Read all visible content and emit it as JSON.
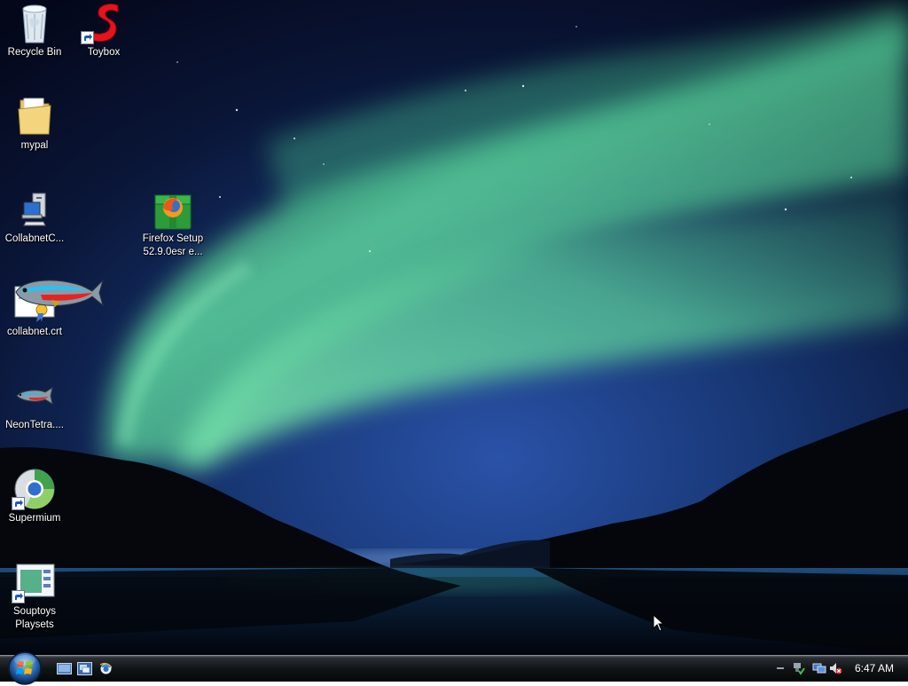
{
  "desktop": {
    "icons": [
      {
        "label": "Recycle Bin",
        "icon": "recycle-bin-icon"
      },
      {
        "label": "Toybox",
        "icon": "toybox-icon"
      },
      {
        "label": "mypal",
        "icon": "folder-icon"
      },
      {
        "label": "CollabnetC...",
        "icon": "computer-program-icon"
      },
      {
        "label": "Firefox Setup\n52.9.0esr e...",
        "icon": "firefox-installer-icon"
      },
      {
        "label": "collabnet.crt",
        "icon": "certificate-icon"
      },
      {
        "label": "NeonTetra....",
        "icon": "neon-tetra-fish-icon"
      },
      {
        "label": "Supermium",
        "icon": "supermium-browser-icon"
      },
      {
        "label": "Souptoys\nPlaysets",
        "icon": "souptoys-playsets-icon"
      }
    ]
  },
  "taskbar": {
    "start_icon": "windows-start-orb-icon",
    "quick_launch": [
      "show-desktop-icon",
      "switch-windows-icon",
      "internet-explorer-icon"
    ],
    "tray": {
      "icons": [
        "tray-chevron-icon",
        "safely-remove-hardware-icon",
        "network-icon",
        "volume-muted-icon"
      ],
      "clock": "6:47 AM"
    }
  },
  "colors": {
    "aurora": "#4fd19a",
    "sky_dark": "#060a1c",
    "sky_blue": "#1d3f8a",
    "taskbar": "#111417"
  }
}
